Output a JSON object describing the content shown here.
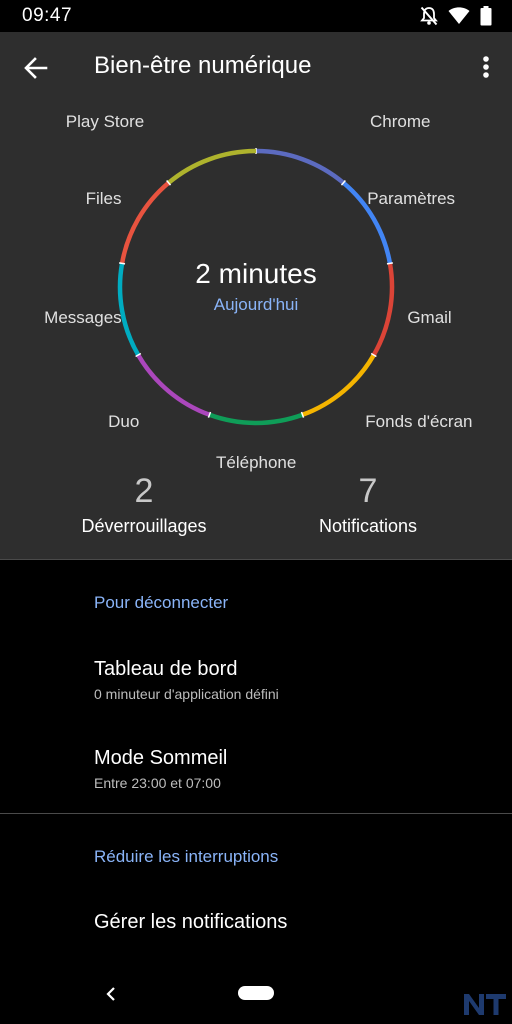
{
  "status_bar": {
    "time": "09:47"
  },
  "app_bar": {
    "title": "Bien-être numérique"
  },
  "usage": {
    "total": "2 minutes",
    "period": "Aujourd'hui",
    "apps": [
      {
        "label": "Chrome",
        "color": "#5c6bc0"
      },
      {
        "label": "Paramètres",
        "color": "#4285f4"
      },
      {
        "label": "Gmail",
        "color": "#db4437"
      },
      {
        "label": "Fonds d'écran",
        "color": "#f4b400"
      },
      {
        "label": "Téléphone",
        "color": "#0f9d58"
      },
      {
        "label": "Duo",
        "color": "#ab47bc"
      },
      {
        "label": "Messages",
        "color": "#00acc1"
      },
      {
        "label": "Files",
        "color": "#e8533f"
      },
      {
        "label": "Play Store",
        "color": "#aeb32d"
      }
    ]
  },
  "stats": {
    "unlocks": {
      "value": "2",
      "label": "Déverrouillages"
    },
    "notifications": {
      "value": "7",
      "label": "Notifications"
    }
  },
  "disconnect": {
    "header": "Pour déconnecter",
    "dashboard": {
      "title": "Tableau de bord",
      "subtitle": "0 minuteur d'application défini"
    },
    "sleep": {
      "title": "Mode Sommeil",
      "subtitle": "Entre 23:00 et 07:00"
    }
  },
  "interruptions": {
    "header": "Réduire les interruptions",
    "manage": {
      "title": "Gérer les notifications"
    }
  },
  "watermark": "NT"
}
